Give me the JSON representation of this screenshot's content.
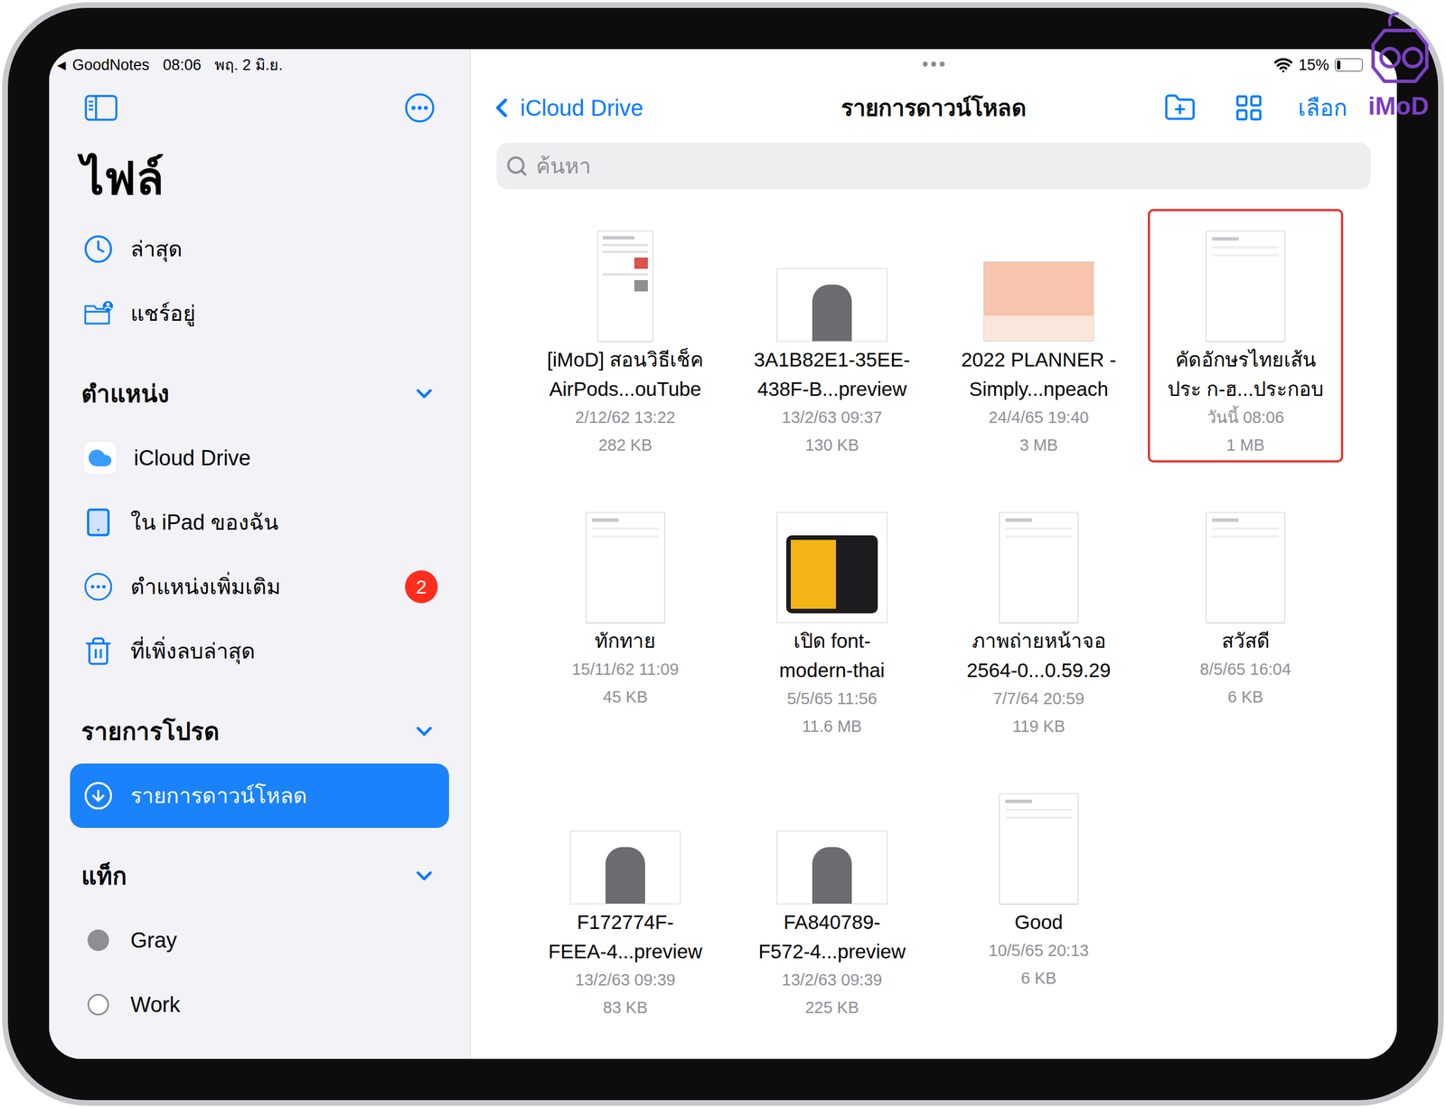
{
  "status_bar": {
    "back_arrow": "◀",
    "back_app": "GoodNotes",
    "time": "08:06",
    "date": "พฤ. 2 มิ.ย.",
    "battery": "15%",
    "battery_level": 0.15
  },
  "watermark": "iMoD",
  "sidebar": {
    "title": "ไฟล์",
    "top_items": [
      {
        "label": "ล่าสุด",
        "kind": "recent",
        "selected": false
      },
      {
        "label": "แชร์อยู่",
        "kind": "shared",
        "selected": false
      }
    ],
    "sections": [
      {
        "heading": "ตำแหน่ง",
        "expanded": true,
        "items": [
          {
            "label": "iCloud Drive",
            "kind": "icloud",
            "selected": false
          },
          {
            "label": "ใน iPad ของฉัน",
            "kind": "ipad",
            "selected": false
          },
          {
            "label": "ตำแหน่งเพิ่มเติม",
            "kind": "more",
            "selected": false,
            "badge": "2"
          },
          {
            "label": "ที่เพิ่งลบล่าสุด",
            "kind": "trash",
            "selected": false
          }
        ]
      },
      {
        "heading": "รายการโปรด",
        "expanded": true,
        "items": [
          {
            "label": "รายการดาวน์โหลด",
            "kind": "download",
            "selected": true
          }
        ]
      },
      {
        "heading": "แท็ก",
        "expanded": true,
        "items": [
          {
            "label": "Gray",
            "kind": "tag",
            "selected": false,
            "color": "#8e8e93"
          },
          {
            "label": "Work",
            "kind": "tag",
            "selected": false,
            "color": null
          }
        ]
      }
    ]
  },
  "toolbar": {
    "back": "iCloud Drive",
    "title": "รายการดาวน์โหลด",
    "select": "เลือก"
  },
  "search": {
    "placeholder": "ค้นหา"
  },
  "files": [
    {
      "name_lines": [
        "[iMoD] สอนวิธีเช็ค",
        "AirPods...ouTube"
      ],
      "date": "2/12/62 13:22",
      "size": "282 KB",
      "kind": "doc",
      "highlighted": false
    },
    {
      "name_lines": [
        "3A1B82E1-35EE-",
        "438F-B...preview"
      ],
      "date": "13/2/63 09:37",
      "size": "130 KB",
      "kind": "photo",
      "highlighted": false
    },
    {
      "name_lines": [
        "2022 PLANNER -",
        "Simply...npeach"
      ],
      "date": "24/4/65 19:40",
      "size": "3 MB",
      "kind": "planner",
      "highlighted": false
    },
    {
      "name_lines": [
        "คัดอักษรไทยเส้น",
        "ประ ก-ฮ...ประกอบ"
      ],
      "date": "วันนี้ 08:06",
      "size": "1 MB",
      "kind": "page",
      "highlighted": true
    },
    {
      "name_lines": [
        "ทักทาย"
      ],
      "date": "15/11/62 11:09",
      "size": "45 KB",
      "kind": "page",
      "highlighted": false
    },
    {
      "name_lines": [
        "เปิด font-",
        "modern-thai"
      ],
      "date": "5/5/65 11:56",
      "size": "11.6 MB",
      "kind": "poster",
      "highlighted": false
    },
    {
      "name_lines": [
        "ภาพถ่ายหน้าจอ",
        "2564-0...0.59.29"
      ],
      "date": "7/7/64 20:59",
      "size": "119 KB",
      "kind": "page",
      "highlighted": false
    },
    {
      "name_lines": [
        "สวัสดี"
      ],
      "date": "8/5/65 16:04",
      "size": "6 KB",
      "kind": "page",
      "highlighted": false
    },
    {
      "name_lines": [
        "F172774F-",
        "FEEA-4...preview"
      ],
      "date": "13/2/63 09:39",
      "size": "83 KB",
      "kind": "photo",
      "highlighted": false
    },
    {
      "name_lines": [
        "FA840789-",
        "F572-4...preview"
      ],
      "date": "13/2/63 09:39",
      "size": "225 KB",
      "kind": "photo",
      "highlighted": false
    },
    {
      "name_lines": [
        "Good"
      ],
      "date": "10/5/65 20:13",
      "size": "6 KB",
      "kind": "page",
      "highlighted": false
    }
  ]
}
